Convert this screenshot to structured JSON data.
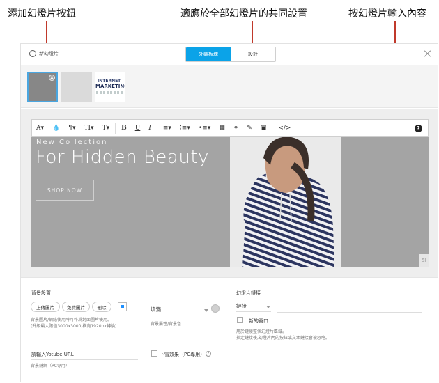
{
  "annotations": {
    "add_slide": "添加幻燈片按鈕",
    "common_settings": "適應於全部幻燈片的共同設置",
    "slide_content": "按幻燈片輸入內容"
  },
  "topbar": {
    "add_label": "新幻燈片",
    "tabs": [
      {
        "label": "外觀板塊",
        "active": true
      },
      {
        "label": "設計",
        "active": false
      }
    ]
  },
  "thumbnails": [
    {
      "type": "gray"
    },
    {
      "type": "light"
    },
    {
      "type": "image",
      "line1": "INTERNET",
      "line2": "MARKETING"
    }
  ],
  "toolbar": {
    "items": [
      "A▾",
      "💧",
      "¶▾",
      "TI▾",
      "T▾",
      "B",
      "U",
      "I",
      "≡▾",
      "⁝≡▾",
      "•≡▾",
      "▦",
      "⚭",
      "✎",
      "▣",
      "</>"
    ],
    "help": "?"
  },
  "slide": {
    "subtitle": "New Collection",
    "title": "For Hidden Beauty",
    "button": "SHOP NOW",
    "corner": "5I",
    "colors": {
      "background": "#a4a4a4"
    }
  },
  "bottom": {
    "bg_title": "背景設置",
    "upload": "上傳圖片",
    "free": "免費圖片",
    "delete": "刪除",
    "bg_hint1": "背景圖片/網絡使用時可作爲封面圖片使用。",
    "bg_hint2": "(升級最大限值3000x3000,橫向1920px轉換)",
    "fill_value": "填滿",
    "fill_hint": "背景屬性/背景色",
    "youtube_placeholder": "請輸入Yotube URL",
    "youtube_hint": "背景鏈網（PC專用）",
    "snow_label": "下雪效果（PC專用）",
    "link_title": "幻燈片鏈接",
    "link_select": "鏈接",
    "new_window": "新的窗口",
    "link_hint1": "用於鏈接整個幻燈片區域。",
    "link_hint2": "指定鏈接後,幻燈片內的按鈕或文本鏈接會被忽略。"
  }
}
